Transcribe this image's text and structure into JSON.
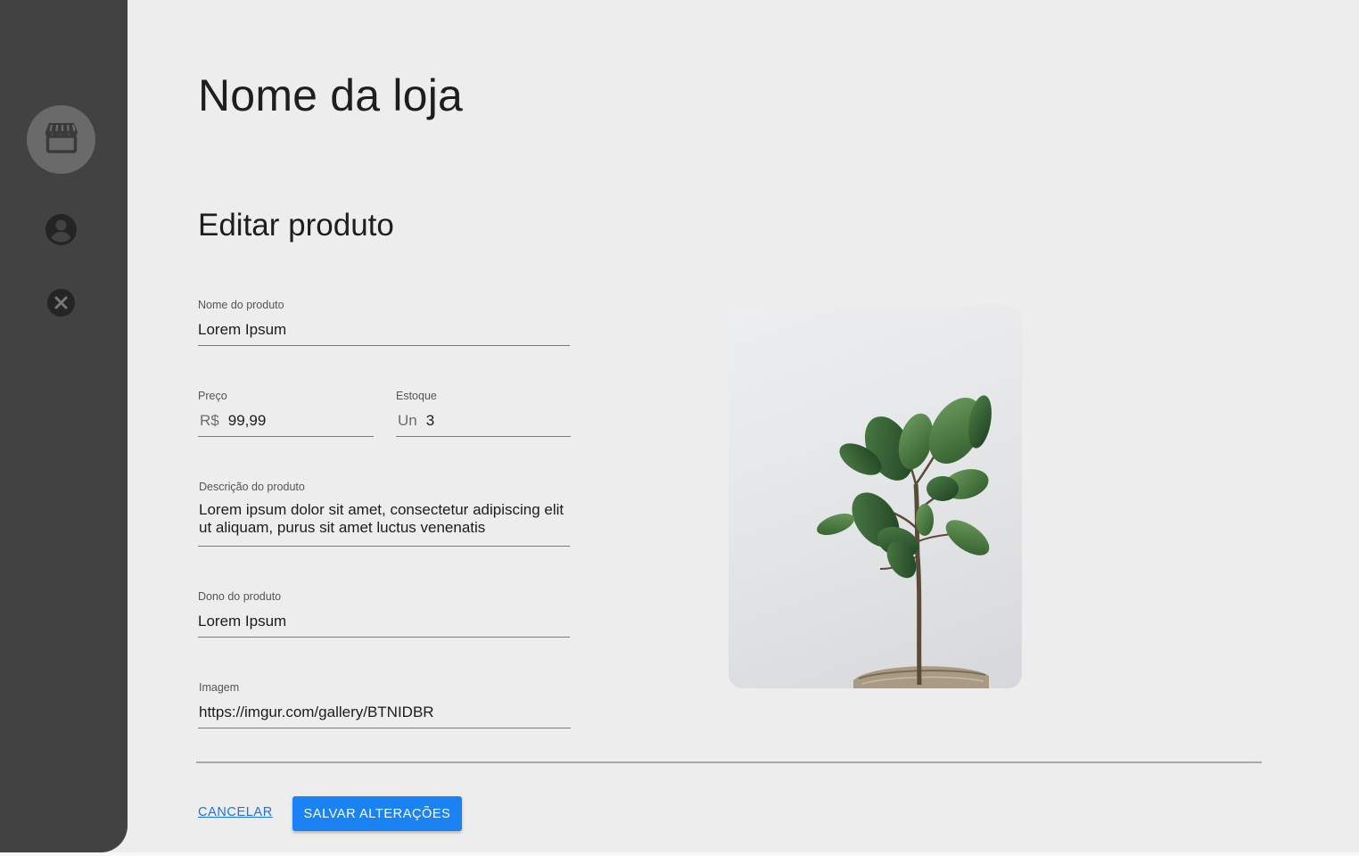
{
  "sidebar": {
    "items": [
      {
        "icon": "store-icon",
        "active": true
      },
      {
        "icon": "account-circle-icon",
        "active": false
      },
      {
        "icon": "close-circle-icon",
        "active": false
      }
    ]
  },
  "header": {
    "store_name": "Nome da loja"
  },
  "form": {
    "title": "Editar produto",
    "product_name": {
      "label": "Nome do produto",
      "value": "Lorem Ipsum"
    },
    "price": {
      "label": "Preço",
      "prefix": "R$",
      "value": "99,99"
    },
    "stock": {
      "label": "Estoque",
      "prefix": "Un",
      "value": "3"
    },
    "description": {
      "label": "Descrição do produto",
      "value": "Lorem ipsum dolor sit amet, consectetur adipiscing elit ut aliquam, purus sit amet luctus venenatis"
    },
    "owner": {
      "label": "Dono do produto",
      "value": "Lorem Ipsum"
    },
    "image": {
      "label": "Imagem",
      "value": "https://imgur.com/gallery/BTNIDBR"
    }
  },
  "actions": {
    "cancel_label": "CANCELAR",
    "save_label": "SALVAR ALTERAÇÕES"
  },
  "colors": {
    "sidebar": "#424242",
    "accent": "#1a82f2",
    "background": "#ededed"
  }
}
